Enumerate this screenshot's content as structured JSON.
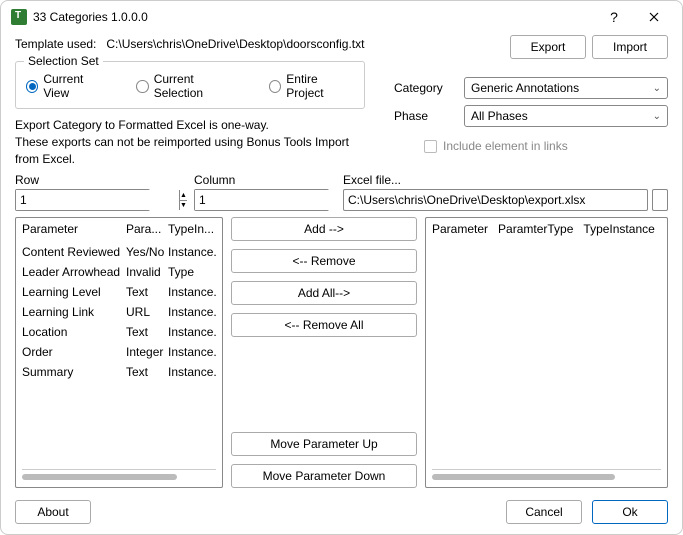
{
  "window": {
    "title": "33 Categories 1.0.0.0"
  },
  "template": {
    "label": "Template used:",
    "path": "C:\\Users\\chris\\OneDrive\\Desktop\\doorsconfig.txt"
  },
  "buttons": {
    "export": "Export",
    "import": "Import",
    "about": "About",
    "cancel": "Cancel",
    "ok": "Ok",
    "add": "Add -->",
    "remove": "<-- Remove",
    "addAll": "Add All-->",
    "removeAll": "<-- Remove All",
    "moveUp": "Move Parameter Up",
    "moveDown": "Move Parameter Down"
  },
  "fieldset": {
    "legend": "Selection Set",
    "opt1": "Current View",
    "opt2": "Current Selection",
    "opt3": "Entire Project"
  },
  "category": {
    "label": "Category",
    "value": "Generic Annotations"
  },
  "phase": {
    "label": "Phase",
    "value": "All Phases"
  },
  "desc": {
    "line1": "Export Category to Formatted Excel is one-way.",
    "line2": "These exports can not be reimported using Bonus Tools Import from Excel."
  },
  "includeLinks": "Include element in links",
  "row": {
    "label": "Row",
    "value": "1"
  },
  "column": {
    "label": "Column",
    "value": "1"
  },
  "excel": {
    "label": "Excel file...",
    "value": "C:\\Users\\chris\\OneDrive\\Desktop\\export.xlsx"
  },
  "leftList": {
    "headers": {
      "c1": "Parameter",
      "c2": "Para...",
      "c3": "TypeIn..."
    },
    "rows": [
      {
        "c1": "Content Reviewed",
        "c2": "Yes/No",
        "c3": "Instance..."
      },
      {
        "c1": "Leader Arrowhead",
        "c2": "Invalid",
        "c3": "Type"
      },
      {
        "c1": "Learning Level",
        "c2": "Text",
        "c3": "Instance..."
      },
      {
        "c1": "Learning Link",
        "c2": "URL",
        "c3": "Instance..."
      },
      {
        "c1": "Location",
        "c2": "Text",
        "c3": "Instance..."
      },
      {
        "c1": "Order",
        "c2": "Integer",
        "c3": "Instance..."
      },
      {
        "c1": "Summary",
        "c2": "Text",
        "c3": "Instance..."
      }
    ]
  },
  "rightList": {
    "headers": {
      "c1": "Parameter",
      "c2": "ParamterType",
      "c3": "TypeInstance"
    }
  }
}
